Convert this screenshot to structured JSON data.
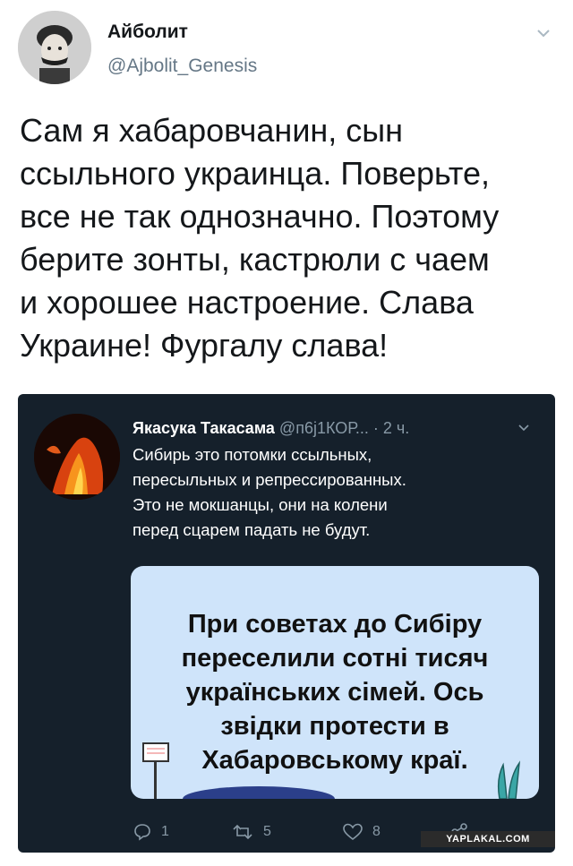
{
  "tweet": {
    "author_name": "Айболит",
    "author_handle": "@Ajbolit_Genesis",
    "text": "Сам я хабаровчанин, сын\nссыльного украинца. Поверьте,\nвсе не так однозначно. Поэтому\nберите зонты, кастрюли с чаем\nи хорошее настроение. Слава\nУкраине! Фургалу слава!",
    "menu_icon": "chevron-down-icon"
  },
  "quoted_tweet": {
    "author_name": "Якасука Такасама",
    "author_handle": "@п6j1КОР...",
    "time": "· 2 ч.",
    "text": "Сибирь это потомки ссыльных,\nпересыльных и репрессированных.\nЭто не мокшанцы, они на колени\nперед сцарем падать не будут.",
    "image_caption": "При советах до Сибіру\nпереселили сотні тисяч\nукраїнських сімей. Ось\nзвідки протести в\nХабаровському краї.",
    "actions": {
      "reply_count": "1",
      "retweet_count": "5",
      "like_count": "8"
    },
    "colors": {
      "background": "#15202b",
      "image_background": "#cfe4fa",
      "secondary_text": "#8899a6"
    }
  },
  "watermark": "YAPLAKAL.COM"
}
